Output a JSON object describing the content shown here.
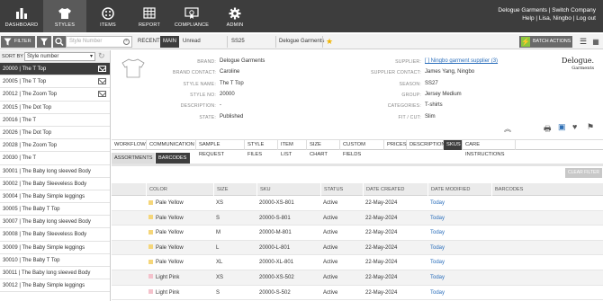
{
  "nav": {
    "items": [
      {
        "label": "DASHBOARD",
        "icon": "bar-chart-icon"
      },
      {
        "label": "STYLES",
        "icon": "tshirt-icon"
      },
      {
        "label": "ITEMS",
        "icon": "buttons-icon"
      },
      {
        "label": "REPORT",
        "icon": "table-icon"
      },
      {
        "label": "COMPLIANCE",
        "icon": "certificate-icon"
      },
      {
        "label": "ADMIN",
        "icon": "gear-icon"
      }
    ],
    "active": "STYLES",
    "user_line1": "Delogue Garments | Switch Company",
    "user_line2": "Help | Lisa, Ningbo | Log out"
  },
  "toolbar": {
    "filter_label": "FILTER",
    "search_placeholder": "Style Number",
    "tab_recent": "RECENT",
    "tab_main": "MAIN",
    "status": "Unread",
    "season": "SS25",
    "brand": "Delogue Garments",
    "batch_label": "BATCH ACTIONS"
  },
  "sidebar": {
    "sort_label": "SORT BY",
    "sort_value": "Style number",
    "items": [
      {
        "label": "20000 | The T Top",
        "icon": true,
        "selected": true
      },
      {
        "label": "20005 | The T Top",
        "icon": true
      },
      {
        "label": "20012 | The Zoom Top",
        "icon": true
      },
      {
        "label": "20015 | The Dot Top"
      },
      {
        "label": "20016 | The T"
      },
      {
        "label": "20026 | The Dot Top"
      },
      {
        "label": "20028 | The Zoom Top"
      },
      {
        "label": "20030 | The T"
      },
      {
        "label": "30001 | The Baby long sleeved Body"
      },
      {
        "label": "30002 | The Baby Sleeveless Body"
      },
      {
        "label": "30004 | The Baby Simple leggings"
      },
      {
        "label": "30005 | The Baby T Top"
      },
      {
        "label": "30007 | The Baby long sleeved Body"
      },
      {
        "label": "30008 | The Baby Sleeveless Body"
      },
      {
        "label": "30009 | The Baby Simple leggings"
      },
      {
        "label": "30010 | The Baby T Top"
      },
      {
        "label": "30011 | The Baby long sleeved Body"
      },
      {
        "label": "30012 | The Baby Simple leggings"
      }
    ]
  },
  "detail": {
    "left": [
      {
        "key": "BRAND:",
        "value": "Delogue Garments"
      },
      {
        "key": "BRAND CONTACT:",
        "value": "Caroline"
      },
      {
        "key": "STYLE NAME:",
        "value": "The T Top"
      },
      {
        "key": "STYLE NO:",
        "value": "20000"
      },
      {
        "key": "DESCRIPTION:",
        "value": "-"
      },
      {
        "key": "STATE:",
        "value": "Published"
      }
    ],
    "right": [
      {
        "key": "SUPPLIER:",
        "value": "[ ] Ningbo garment supplier (3)"
      },
      {
        "key": "SUPPLIER CONTACT:",
        "value": "James Yang, Ningbo"
      },
      {
        "key": "SEASON:",
        "value": "SS27"
      },
      {
        "key": "GROUP:",
        "value": "Jersey Medium"
      },
      {
        "key": "CATEGORIES:",
        "value": "T-shirts"
      },
      {
        "key": "FIT / CUT:",
        "value": "Slim"
      }
    ],
    "logo_line1": "Delogue.",
    "logo_line2": "Garments"
  },
  "tabs": [
    "WORKFLOW",
    "COMMUNICATION",
    "SAMPLE REQUEST",
    "STYLE FILES",
    "ITEM LIST",
    "SIZE CHART",
    "CUSTOM FIELDS",
    "PRICES",
    "DESCRIPTION",
    "SKUS",
    "CARE INSTRUCTIONS"
  ],
  "active_tab": "SKUS",
  "subtabs": [
    "ASSORTMENTS",
    "BARCODES"
  ],
  "active_subtab": "BARCODES",
  "clear_filter": "CLEAR FILTER",
  "table": {
    "headers": [
      "COLOR",
      "SIZE",
      "SKU",
      "STATUS",
      "DATE CREATED",
      "DATE MODIFIED",
      "BARCODES"
    ],
    "rows": [
      {
        "color": "Pale Yellow",
        "swatch": "#f5d67a",
        "size": "XS",
        "sku": "20000-XS-801",
        "status": "Active",
        "created": "22-May-2024",
        "modified": "Today",
        "barcodes": ""
      },
      {
        "color": "Pale Yellow",
        "swatch": "#f5d67a",
        "size": "S",
        "sku": "20000-S-801",
        "status": "Active",
        "created": "22-May-2024",
        "modified": "Today",
        "barcodes": ""
      },
      {
        "color": "Pale Yellow",
        "swatch": "#f5d67a",
        "size": "M",
        "sku": "20000-M-801",
        "status": "Active",
        "created": "22-May-2024",
        "modified": "Today",
        "barcodes": ""
      },
      {
        "color": "Pale Yellow",
        "swatch": "#f5d67a",
        "size": "L",
        "sku": "20000-L-801",
        "status": "Active",
        "created": "22-May-2024",
        "modified": "Today",
        "barcodes": ""
      },
      {
        "color": "Pale Yellow",
        "swatch": "#f5d67a",
        "size": "XL",
        "sku": "20000-XL-801",
        "status": "Active",
        "created": "22-May-2024",
        "modified": "Today",
        "barcodes": ""
      },
      {
        "color": "Light Pink",
        "swatch": "#f4c2cc",
        "size": "XS",
        "sku": "20000-XS-502",
        "status": "Active",
        "created": "22-May-2024",
        "modified": "Today",
        "barcodes": ""
      },
      {
        "color": "Light Pink",
        "swatch": "#f4c2cc",
        "size": "S",
        "sku": "20000-S-502",
        "status": "Active",
        "created": "22-May-2024",
        "modified": "Today",
        "barcodes": ""
      }
    ]
  },
  "colors": {
    "nav_bg": "#3d3d3d",
    "link": "#2a6ebb",
    "accent_green": "#8cc63f",
    "star": "#f0b400"
  }
}
